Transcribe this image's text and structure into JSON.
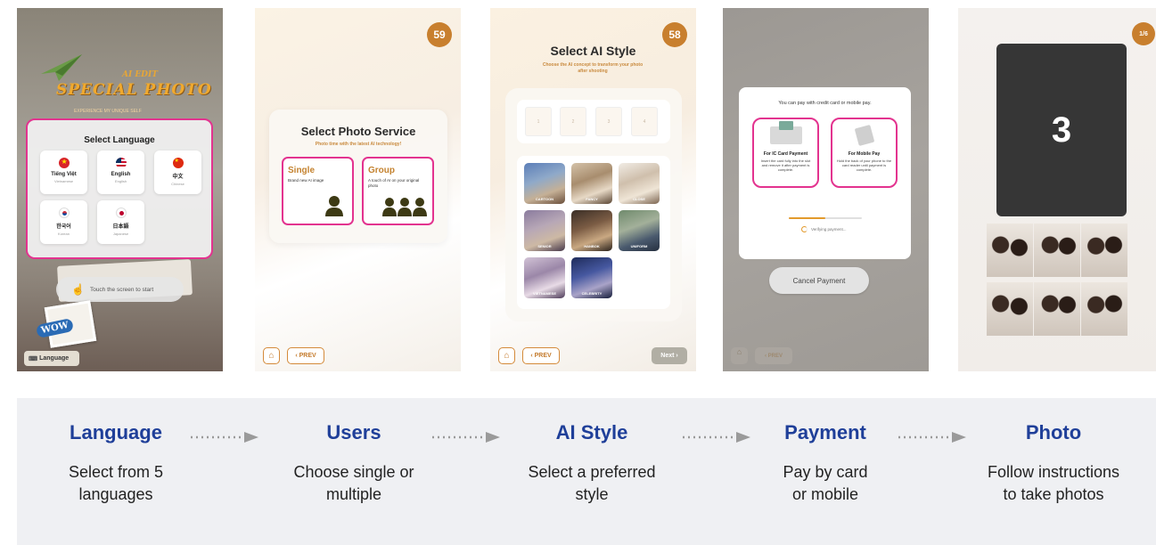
{
  "screen_language": {
    "logo_small": "AI EDIT",
    "logo_big": "SPECIAL PHOTO",
    "logo_tag": "EXPERIENCE MY UNIQUE SELF",
    "panel_title": "Select Language",
    "languages": [
      {
        "name": "Tiếng Việt",
        "sub": "Vietnamese"
      },
      {
        "name": "English",
        "sub": "English"
      },
      {
        "name": "中文",
        "sub": "Chinese"
      },
      {
        "name": "한국어",
        "sub": "Korean"
      },
      {
        "name": "日本語",
        "sub": "Japanese"
      }
    ],
    "touch_label": "Touch the screen to start",
    "language_button": "Language",
    "sticker": "WOW"
  },
  "screen_service": {
    "countdown": "59",
    "title": "Select Photo Service",
    "subtitle": "Photo time with the latest AI technology!",
    "single_title": "Single",
    "single_desc": "Brand new AI image",
    "group_title": "Group",
    "group_desc": "A touch of AI on your original photo",
    "prev": "‹ PREV"
  },
  "screen_style": {
    "countdown": "58",
    "title": "Select AI Style",
    "subtitle": "Choose the AI concept to transform your photo after shooting",
    "slots": [
      "1",
      "2",
      "3",
      "4"
    ],
    "styles": [
      "CARTOON",
      "FANCY",
      "CLOSE",
      "SENIOR",
      "HANBOK",
      "UNIFORM",
      "VIETNAMESE",
      "CELEBRITY"
    ],
    "prev": "‹ PREV",
    "next": "Next ›"
  },
  "screen_payment": {
    "header": "You can pay with credit card or mobile pay.",
    "card_title": "For IC Card Payment",
    "card_desc": "Insert the card fully into the slot and remove it after payment is complete.",
    "mobile_title": "For Mobile Pay",
    "mobile_desc": "Hold the back of your phone to the card reader until payment is complete.",
    "progress": 0.5,
    "verifying": "Verifying payment...",
    "cancel": "Cancel Payment",
    "prev": "‹ PREV"
  },
  "screen_photo": {
    "counter": "1/6",
    "countdown_number": "3"
  },
  "flow": [
    {
      "title": "Language",
      "desc1": "Select from 5",
      "desc2": "languages"
    },
    {
      "title": "Users",
      "desc1": "Choose single or",
      "desc2": "multiple"
    },
    {
      "title": "AI Style",
      "desc1": "Select a preferred",
      "desc2": "style"
    },
    {
      "title": "Payment",
      "desc1": "Pay by card",
      "desc2": "or mobile"
    },
    {
      "title": "Photo",
      "desc1": "Follow instructions",
      "desc2": "to take photos"
    }
  ],
  "colors": {
    "accent_orange": "#c87f2e",
    "highlight_pink": "#e3338f",
    "flow_title_blue": "#1f3f99",
    "flow_bg": "#eff0f3"
  }
}
